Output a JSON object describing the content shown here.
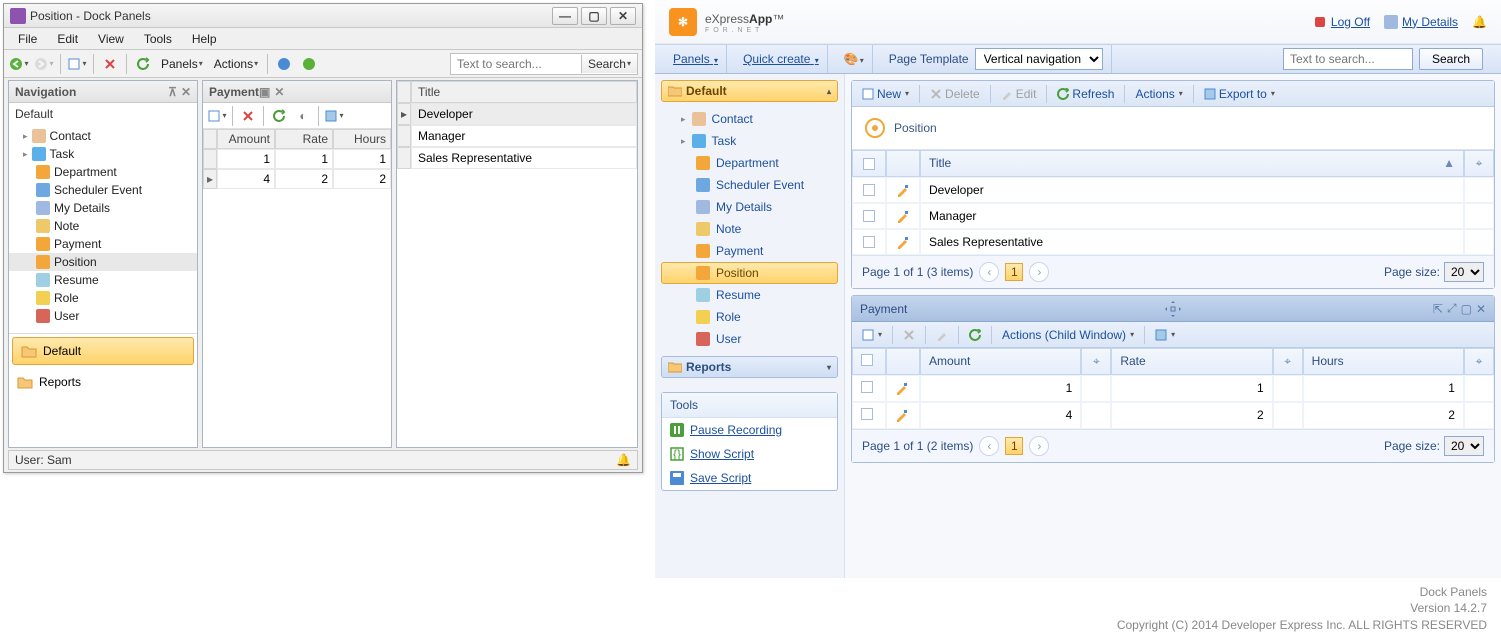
{
  "win": {
    "title": "Position - Dock Panels",
    "menu": [
      "File",
      "Edit",
      "View",
      "Tools",
      "Help"
    ],
    "toolbar": {
      "panels": "Panels",
      "actions": "Actions",
      "search_placeholder": "Text to search...",
      "search_btn": "Search"
    },
    "nav": {
      "title": "Navigation",
      "section": "Default",
      "items": [
        {
          "label": "Contact"
        },
        {
          "label": "Task"
        },
        {
          "label": "Department"
        },
        {
          "label": "Scheduler Event"
        },
        {
          "label": "My Details"
        },
        {
          "label": "Note"
        },
        {
          "label": "Payment"
        },
        {
          "label": "Position",
          "sel": true
        },
        {
          "label": "Resume"
        },
        {
          "label": "Role"
        },
        {
          "label": "User"
        }
      ],
      "groups": {
        "default": "Default",
        "reports": "Reports"
      }
    },
    "payment": {
      "title": "Payment",
      "cols": {
        "amount": "Amount",
        "rate": "Rate",
        "hours": "Hours"
      },
      "rows": [
        {
          "amount": "1",
          "rate": "1",
          "hours": "1"
        },
        {
          "amount": "4",
          "rate": "2",
          "hours": "2"
        }
      ]
    },
    "position": {
      "col": "Title",
      "rows": [
        "Developer",
        "Manager",
        "Sales Representative"
      ]
    },
    "status": "User: Sam"
  },
  "web": {
    "brand_a": "eXpress",
    "brand_b": "App",
    "brand_tm": "™",
    "brand_sub": "F O R  . N E T",
    "logoff": "Log Off",
    "mydetails": "My Details",
    "panels": "Panels",
    "quick": "Quick create",
    "tpl_label": "Page Template",
    "tpl_value": "Vertical navigation",
    "search_placeholder": "Text to search...",
    "search_btn": "Search",
    "nav": {
      "default": "Default",
      "items": [
        {
          "label": "Contact"
        },
        {
          "label": "Task"
        },
        {
          "label": "Department"
        },
        {
          "label": "Scheduler Event"
        },
        {
          "label": "My Details"
        },
        {
          "label": "Note"
        },
        {
          "label": "Payment"
        },
        {
          "label": "Position",
          "sel": true
        },
        {
          "label": "Resume"
        },
        {
          "label": "Role"
        },
        {
          "label": "User"
        }
      ],
      "reports": "Reports"
    },
    "tools": {
      "title": "Tools",
      "pause": "Pause Recording",
      "show": "Show Script",
      "save": "Save Script"
    },
    "mainbar": {
      "new": "New",
      "delete": "Delete",
      "edit": "Edit",
      "refresh": "Refresh",
      "actions": "Actions",
      "export": "Export to"
    },
    "view_title": "Position",
    "grid": {
      "title_col": "Title",
      "rows": [
        "Developer",
        "Manager",
        "Sales Representative"
      ],
      "pager": "Page 1 of 1 (3 items)",
      "psize_lbl": "Page size:",
      "psize": "20"
    },
    "pay_panel": {
      "title": "Payment",
      "actions": "Actions (Child Window)",
      "cols": {
        "amount": "Amount",
        "rate": "Rate",
        "hours": "Hours"
      },
      "rows": [
        {
          "amount": "1",
          "rate": "1",
          "hours": "1"
        },
        {
          "amount": "4",
          "rate": "2",
          "hours": "2"
        }
      ],
      "pager": "Page 1 of 1 (2 items)",
      "psize_lbl": "Page size:",
      "psize": "20"
    },
    "footer": {
      "l1": "Dock Panels",
      "l2": "Version 14.2.7",
      "l3": "Copyright (C) 2014 Developer Express Inc. ALL RIGHTS RESERVED"
    }
  }
}
